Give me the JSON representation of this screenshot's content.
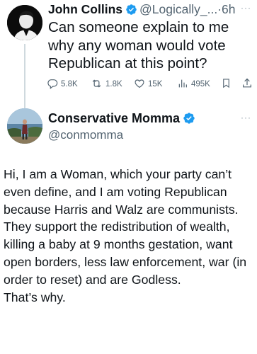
{
  "reply_to": {
    "name": "John Collins",
    "handle": "@Logically_...",
    "dot": "·",
    "time": "6h",
    "more": "···",
    "text": "Can someone explain to me why any woman would vote Republican at this point?",
    "actions": {
      "replies": "5.8K",
      "reposts": "1.8K",
      "likes": "15K",
      "views": "495K"
    }
  },
  "reply": {
    "name": "Conservative Momma",
    "handle": "@conmomma",
    "more": "···",
    "paragraphs": [
      "Hi, I am a Woman, which your party can’t even define, and I am voting Republican because Harris and Walz are communists.",
      "They support the redistribution of wealth, killing a baby at 9 months gestation, want open borders, less law enforcement, war (in order to reset) and are Godless.",
      "That’s why."
    ]
  },
  "colors": {
    "text": "#0f1419",
    "muted": "#536471",
    "verified": "#1d9bf0",
    "thread_line": "#cfd9de"
  }
}
